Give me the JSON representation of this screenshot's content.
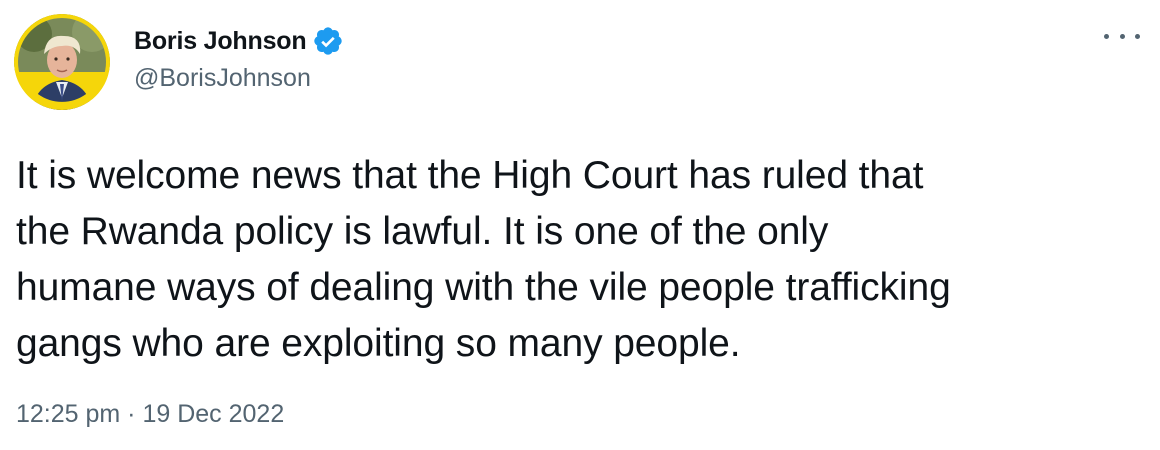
{
  "author": {
    "name": "Boris Johnson",
    "handle": "@BorisJohnson",
    "verified": true
  },
  "tweet": {
    "lines": [
      "It is welcome news that the High Court has ruled that",
      "the Rwanda policy is lawful. It is one of the only",
      "humane ways of dealing with the vile people trafficking",
      "gangs who are exploiting so many people."
    ],
    "timestamp": "12:25 pm · 19 Dec 2022"
  },
  "icons": {
    "verified": "verified-badge-icon",
    "more": "more-options-icon"
  },
  "colors": {
    "text": "#0f1419",
    "secondary": "#536471",
    "verified_blue": "#1d9bf0",
    "avatar_ring": "#f5d60a"
  }
}
